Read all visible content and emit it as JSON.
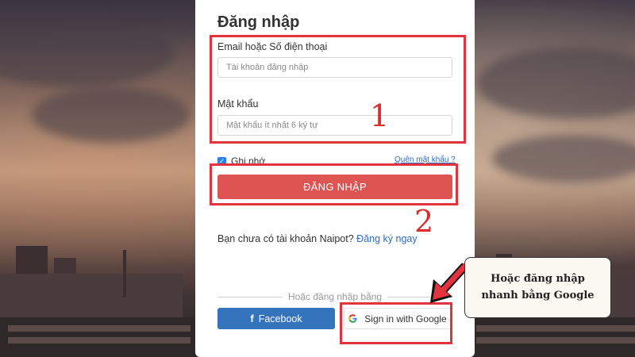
{
  "login": {
    "title": "Đăng nhập",
    "email_label": "Email hoặc Số điện thoại",
    "email_placeholder": "Tài khoản đăng nhập",
    "password_label": "Mật khẩu",
    "password_placeholder": "Mật khẩu ít nhất 6 ký tự",
    "remember_label": "Ghi nhớ",
    "remember_checked": true,
    "forgot_link": "Quên mật khẩu ?",
    "submit_label": "ĐĂNG NHẬP",
    "no_account_text": "Bạn chưa có tài khoản Naipot?",
    "register_link": "Đăng ký ngay",
    "social_divider": "Hoặc đăng nhập bằng",
    "facebook_label": "Facebook",
    "google_label": "Sign in with Google"
  },
  "annotations": {
    "step1": "1",
    "step2": "2",
    "callout": "Hoặc đăng nhập nhanh bằng Google",
    "highlight_color": "#e2333f"
  },
  "colors": {
    "login_button": "#de5452",
    "facebook_button": "#3474bd",
    "link": "#2b6cc4"
  },
  "icons": {
    "facebook": "facebook-icon",
    "google": "google-icon",
    "checkbox": "check-icon",
    "arrow": "arrow-icon"
  }
}
